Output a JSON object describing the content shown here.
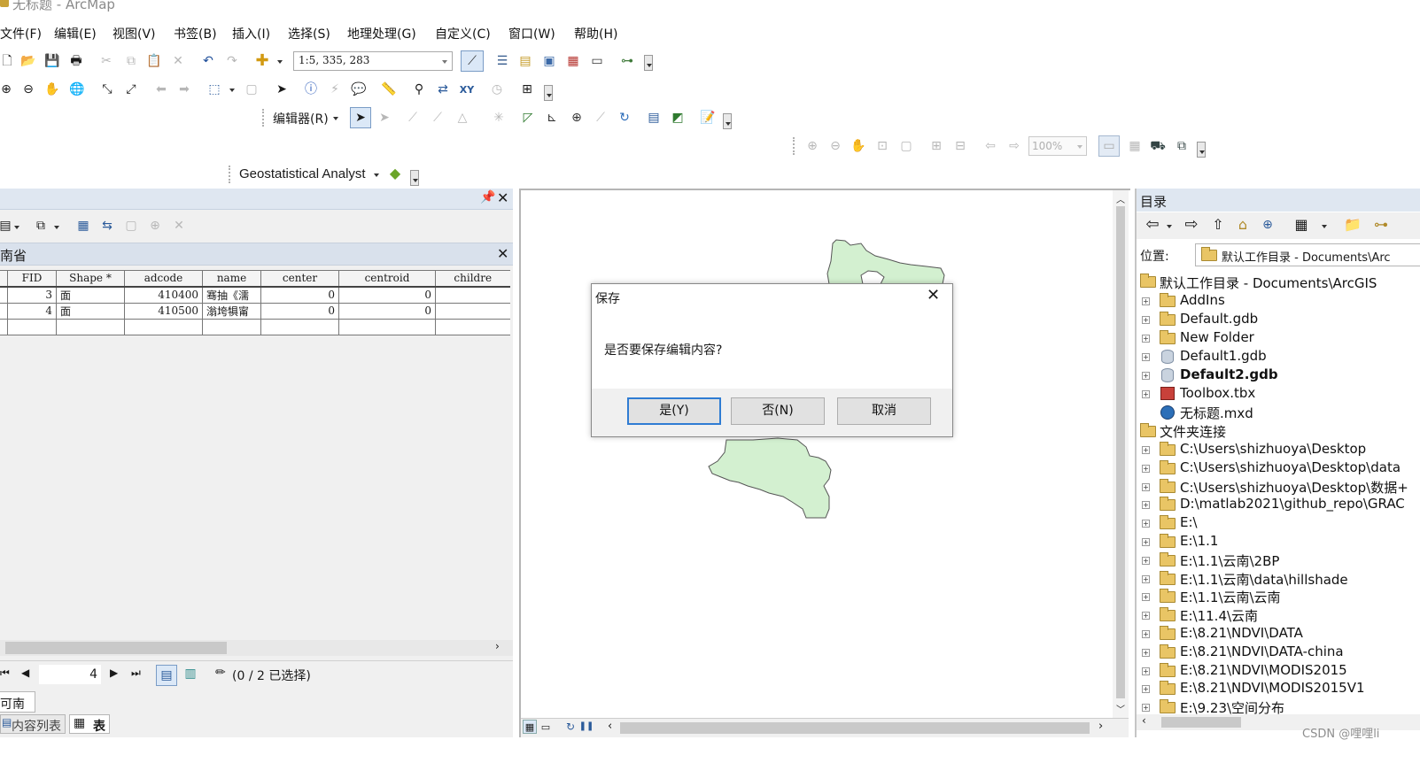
{
  "window": {
    "title": "无标题 - ArcMap"
  },
  "menu": [
    "文件(F)",
    "编辑(E)",
    "视图(V)",
    "书签(B)",
    "插入(I)",
    "选择(S)",
    "地理处理(G)",
    "自定义(C)",
    "窗口(W)",
    "帮助(H)"
  ],
  "toolbar": {
    "scale_value": "1:5, 335, 283",
    "editor_label": "编辑器(R)",
    "layout_zoom": "100%",
    "geostat_label": "Geostatistical Analyst"
  },
  "table_window": {
    "layer_name": "南省",
    "columns": [
      "FID",
      "Shape *",
      "adcode",
      "name",
      "center",
      "centroid",
      "childre"
    ],
    "rows": [
      [
        "3",
        "面",
        "410400",
        "骞抽《濡",
        "0",
        "0",
        ""
      ],
      [
        "4",
        "面",
        "410500",
        "滃垮犋甯",
        "0",
        "0",
        ""
      ]
    ],
    "record_number": "4",
    "selection_status": "(0 / 2 已选择)",
    "bottom_tab": "可南省",
    "tabs": [
      "内容列表",
      "表"
    ]
  },
  "dialog": {
    "title": "保存",
    "message": "是否要保存编辑内容?",
    "buttons": {
      "yes": "是(Y)",
      "no": "否(N)",
      "cancel": "取消"
    }
  },
  "catalog": {
    "title": "目录",
    "location_label": "位置:",
    "location_value": "默认工作目录 - Documents\\Arc",
    "home_node": "默认工作目录 - Documents\\ArcGIS",
    "home_children": [
      "AddIns",
      "Default.gdb",
      "New Folder",
      "Default1.gdb",
      "Default2.gdb",
      "Toolbox.tbx",
      "无标题.mxd"
    ],
    "folder_connections_label": "文件夹连接",
    "folder_connections": [
      "C:\\Users\\shizhuoya\\Desktop",
      "C:\\Users\\shizhuoya\\Desktop\\data",
      "C:\\Users\\shizhuoya\\Desktop\\数据+",
      "D:\\matlab2021\\github_repo\\GRAC",
      "E:\\",
      "E:\\1.1",
      "E:\\1.1\\云南\\2BP",
      "E:\\1.1\\云南\\data\\hillshade",
      "E:\\1.1\\云南\\云南",
      "E:\\11.4\\云南",
      "E:\\8.21\\NDVI\\DATA",
      "E:\\8.21\\NDVI\\DATA-china",
      "E:\\8.21\\NDVI\\MODIS2015",
      "E:\\8.21\\NDVI\\MODIS2015V1",
      "E:\\9.23\\空间分布"
    ]
  },
  "watermark": "CSDN @哩哩li",
  "colors": {
    "accent": "#2f7cd3",
    "polygon_fill": "#d3f0d0",
    "panel_header": "#dfe7f1"
  }
}
